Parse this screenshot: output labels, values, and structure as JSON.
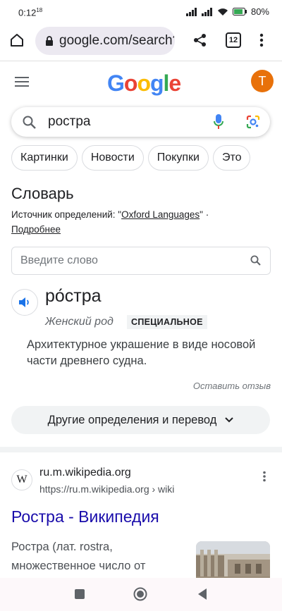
{
  "status_bar": {
    "time": "0:12",
    "time_suffix": "18",
    "battery": "80%"
  },
  "browser": {
    "url": "google.com/search?q",
    "tab_count": "12"
  },
  "google": {
    "logo_letters": [
      "G",
      "o",
      "o",
      "g",
      "l",
      "e"
    ],
    "logo_colors": [
      "#4285F4",
      "#EA4335",
      "#FBBC05",
      "#4285F4",
      "#34A853",
      "#EA4335"
    ],
    "avatar_letter": "T",
    "avatar_color": "#e8710a",
    "query": "ростра",
    "chips": [
      "Картинки",
      "Новости",
      "Покупки",
      "Это"
    ]
  },
  "dictionary": {
    "title": "Словарь",
    "source_prefix": "Источник определений: \"",
    "source_name": "Oxford Languages",
    "source_suffix": "\" ·",
    "more_link": "Подробнее",
    "input_placeholder": "Введите слово",
    "headword": "ро́стра",
    "gender": "Женский род",
    "badge": "СПЕЦИАЛЬНОЕ",
    "definition": "Архитектурное украшение в виде носовой части древнего судна.",
    "feedback": "Оставить отзыв",
    "more_button": "Другие определения и перевод"
  },
  "result": {
    "site_name": "ru.m.wikipedia.org",
    "url": "https://ru.m.wikipedia.org › wiki",
    "title": "Ростра - Википедия",
    "snippet": "Ростра (лат. rostra, множественное число от"
  }
}
